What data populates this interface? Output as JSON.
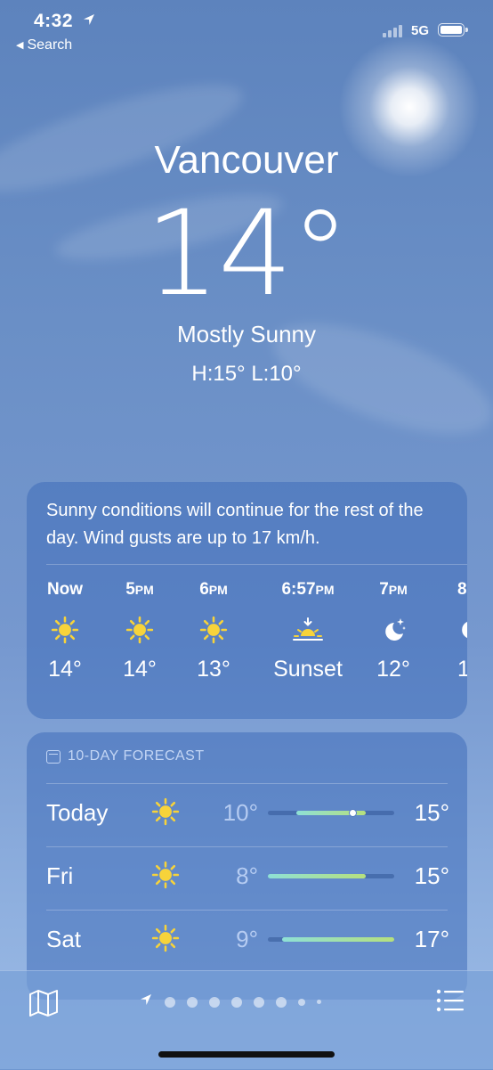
{
  "status_bar": {
    "time": "4:32",
    "location_arrow_icon": "location-arrow-icon",
    "back_label": "Search",
    "network": "5G",
    "battery_icon": "battery-icon"
  },
  "hero": {
    "city": "Vancouver",
    "temperature": "14°",
    "condition": "Mostly Sunny",
    "high_low": "H:15°  L:10°"
  },
  "hourly": {
    "summary": "Sunny conditions will continue for the rest of the day. Wind gusts are up to 17 km/h.",
    "items": [
      {
        "time": "Now",
        "ampm": "",
        "icon": "sun-icon",
        "temp": "14°"
      },
      {
        "time": "5",
        "ampm": "PM",
        "icon": "sun-icon",
        "temp": "14°"
      },
      {
        "time": "6",
        "ampm": "PM",
        "icon": "sun-icon",
        "temp": "13°"
      },
      {
        "time": "6:57",
        "ampm": "PM",
        "icon": "sunset-icon",
        "temp": "Sunset"
      },
      {
        "time": "7",
        "ampm": "PM",
        "icon": "moon-stars-icon",
        "temp": "12°"
      },
      {
        "time": "8",
        "ampm": "",
        "icon": "moon-icon",
        "temp": "1"
      }
    ]
  },
  "forecast": {
    "header": "10-DAY FORECAST",
    "header_icon": "calendar-icon",
    "range_min": 8,
    "range_max": 17,
    "days": [
      {
        "day": "Today",
        "icon": "sun-icon",
        "low": "10°",
        "high": "15°",
        "low_value": 10,
        "high_value": 15,
        "current": 14
      },
      {
        "day": "Fri",
        "icon": "sun-icon",
        "low": "8°",
        "high": "15°",
        "low_value": 8,
        "high_value": 15
      },
      {
        "day": "Sat",
        "icon": "sun-icon",
        "low": "9°",
        "high": "17°",
        "low_value": 9,
        "high_value": 17
      }
    ]
  },
  "bottom_bar": {
    "map_icon": "map-icon",
    "list_icon": "list-icon",
    "page_count": 9,
    "current_page": 0
  },
  "colors": {
    "sun": "#f7d33a",
    "card": "#406eb9",
    "bar_start": "#8ee0d6",
    "bar_end": "#b6e07d"
  }
}
